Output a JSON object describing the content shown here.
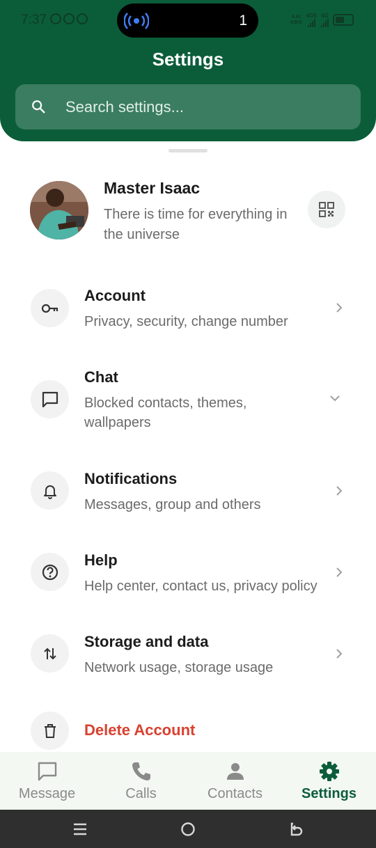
{
  "status_bar": {
    "time": "7:37",
    "island_count": "1",
    "net_speed": "4.41\nKB/S",
    "net_4g5": "4G5",
    "net_4g": "4G"
  },
  "header": {
    "title": "Settings",
    "search_placeholder": "Search settings..."
  },
  "profile": {
    "name": "Master Isaac",
    "status": "There is time for everything in the universe"
  },
  "settings": [
    {
      "icon": "key-icon",
      "title": "Account",
      "subtitle": "Privacy, security, change number",
      "chevron": "chevron-right-icon"
    },
    {
      "icon": "chat-icon",
      "title": "Chat",
      "subtitle": "Blocked contacts, themes, wallpapers",
      "chevron": "chevron-down-icon"
    },
    {
      "icon": "bell-icon",
      "title": "Notifications",
      "subtitle": "Messages, group and others",
      "chevron": "chevron-right-icon"
    },
    {
      "icon": "help-icon",
      "title": "Help",
      "subtitle": "Help center, contact us, privacy policy",
      "chevron": "chevron-right-icon"
    },
    {
      "icon": "storage-icon",
      "title": "Storage and data",
      "subtitle": "Network usage, storage usage",
      "chevron": "chevron-right-icon"
    },
    {
      "icon": "trash-icon",
      "title": "Delete Account",
      "subtitle": ""
    }
  ],
  "bottom_nav": {
    "items": [
      {
        "label": "Message",
        "icon": "message-icon",
        "active": false
      },
      {
        "label": "Calls",
        "icon": "phone-icon",
        "active": false
      },
      {
        "label": "Contacts",
        "icon": "person-icon",
        "active": false
      },
      {
        "label": "Settings",
        "icon": "gear-icon",
        "active": true
      }
    ]
  },
  "colors": {
    "brand_green": "#0b5d3a",
    "danger_red": "#d9412f",
    "nav_background": "#f3f8f3",
    "system_bar": "#2f2f2f"
  }
}
